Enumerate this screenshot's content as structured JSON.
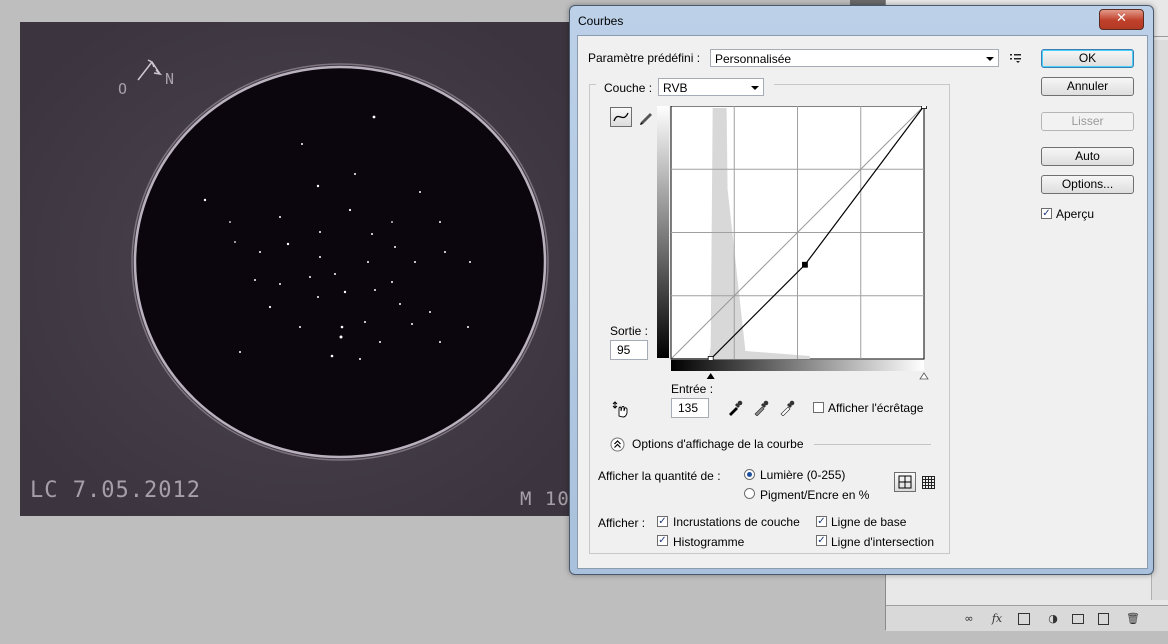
{
  "photo": {
    "date_stamp": "LC 7.05.2012",
    "label": "M 10",
    "compass": {
      "west": "O",
      "north": "N"
    }
  },
  "dialog": {
    "title": "Courbes",
    "close_glyph": "✕",
    "preset": {
      "label": "Paramètre prédéfini :",
      "value": "Personnalisée"
    },
    "buttons": {
      "ok": "OK",
      "cancel": "Annuler",
      "smooth": "Lisser",
      "auto": "Auto",
      "options": "Options..."
    },
    "preview": {
      "label": "Aperçu",
      "checked": true
    },
    "channel": {
      "label": "Couche :",
      "value": "RVB"
    },
    "output": {
      "label": "Sortie :",
      "value": "95"
    },
    "input": {
      "label": "Entrée :",
      "value": "135"
    },
    "show_clipping": {
      "label": "Afficher l'écrêtage",
      "checked": false
    },
    "curve_options": {
      "label": "Options d'affichage de la courbe"
    },
    "show_amount": {
      "label": "Afficher la quantité de :",
      "options": [
        "Lumière (0-255)",
        "Pigment/Encre en %"
      ],
      "selected": "Lumière (0-255)"
    },
    "show": {
      "label": "Afficher :",
      "channel_overlays": "Incrustations de couche",
      "baseline": "Ligne de base",
      "histogram": "Histogramme",
      "intersection_line": "Ligne d'intersection"
    },
    "curve": {
      "points": [
        [
          0,
          0
        ],
        [
          40,
          0
        ],
        [
          135,
          95
        ],
        [
          255,
          255
        ]
      ],
      "range": [
        0,
        255
      ]
    }
  },
  "icons": {
    "curve_tool": "curve-icon",
    "pencil_tool": "pencil-icon",
    "target_adjust": "hand-adjust-icon",
    "black_dropper": "black-eyedropper-icon",
    "gray_dropper": "gray-eyedropper-icon",
    "white_dropper": "white-eyedropper-icon",
    "preset_menu": "preset-menu-icon",
    "simple_grid": "grid-4x4-icon",
    "detailed_grid": "grid-10x10-icon"
  }
}
